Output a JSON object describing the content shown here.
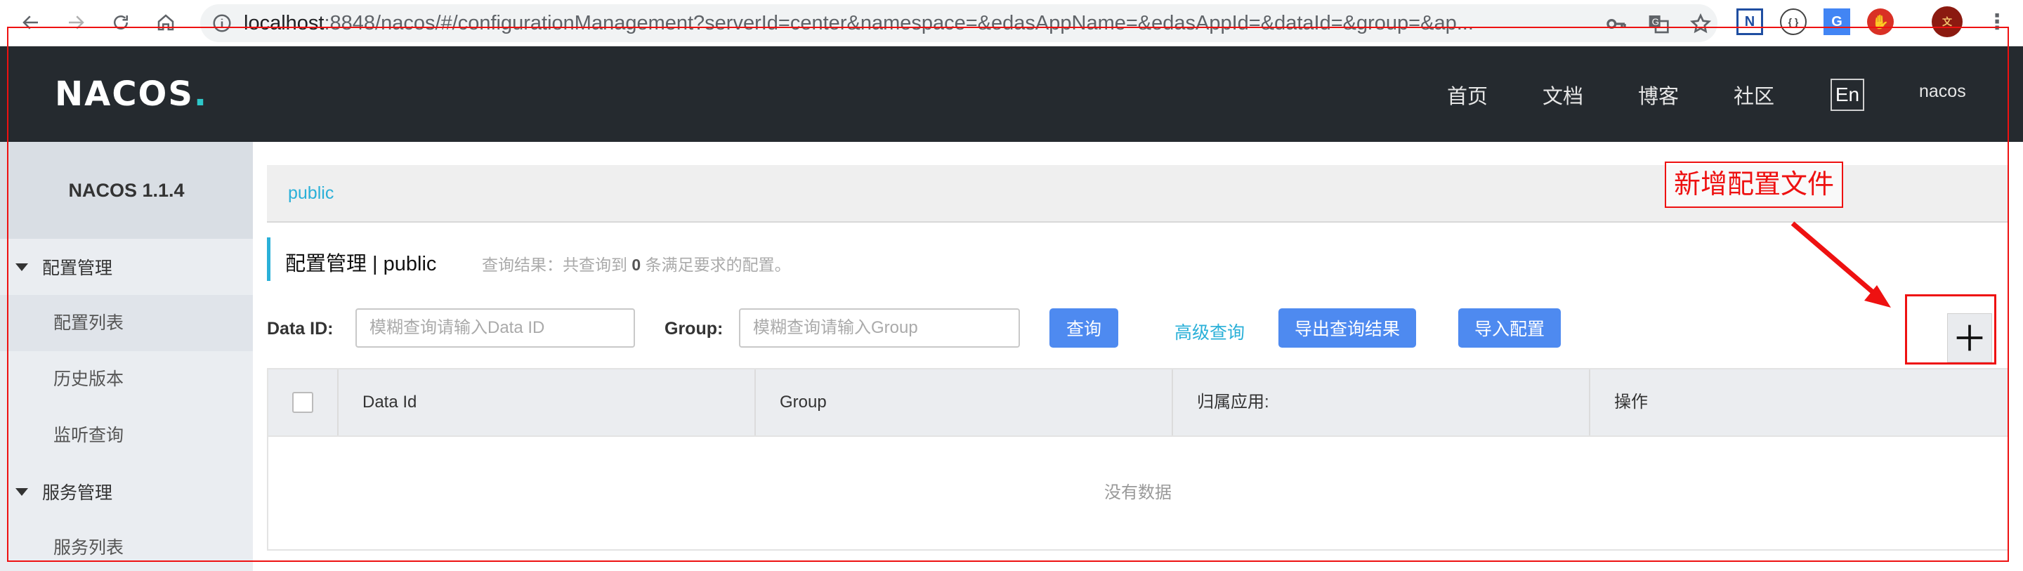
{
  "browser": {
    "url_host": "localhost",
    "url_rest": ":8848/nacos/#/configurationManagement?serverId=center&namespace=&edasAppName=&edasAppId=&dataId=&group=&ap..."
  },
  "header": {
    "logo": "NACOS",
    "logo_dot": ".",
    "nav": [
      "首页",
      "文档",
      "博客",
      "社区"
    ],
    "language_toggle": "En",
    "user": "nacos"
  },
  "sidebar": {
    "version": "NACOS 1.1.4",
    "groups": [
      {
        "label": "配置管理",
        "items": [
          "配置列表",
          "历史版本",
          "监听查询"
        ]
      },
      {
        "label": "服务管理",
        "items": [
          "服务列表"
        ]
      }
    ]
  },
  "main": {
    "namespace_tab": "public",
    "title": "配置管理  |  public",
    "result_prefix": "查询结果：共查询到",
    "result_count": "0",
    "result_suffix": "条满足要求的配置。",
    "dataid_label": "Data ID:",
    "dataid_placeholder": "模糊查询请输入Data ID",
    "group_label": "Group:",
    "group_placeholder": "模糊查询请输入Group",
    "search_button": "查询",
    "advanced_query": "高级查询",
    "export_button": "导出查询结果",
    "import_button": "导入配置",
    "table_headers": [
      "Data Id",
      "Group",
      "归属应用:",
      "操作"
    ],
    "empty_text": "没有数据"
  },
  "annotation": {
    "label": "新增配置文件",
    "color": "#ee1111"
  },
  "colors": {
    "header_bg": "#252a2f",
    "accent_blue": "#4e8af0",
    "link_cyan": "#2ab0d8"
  }
}
